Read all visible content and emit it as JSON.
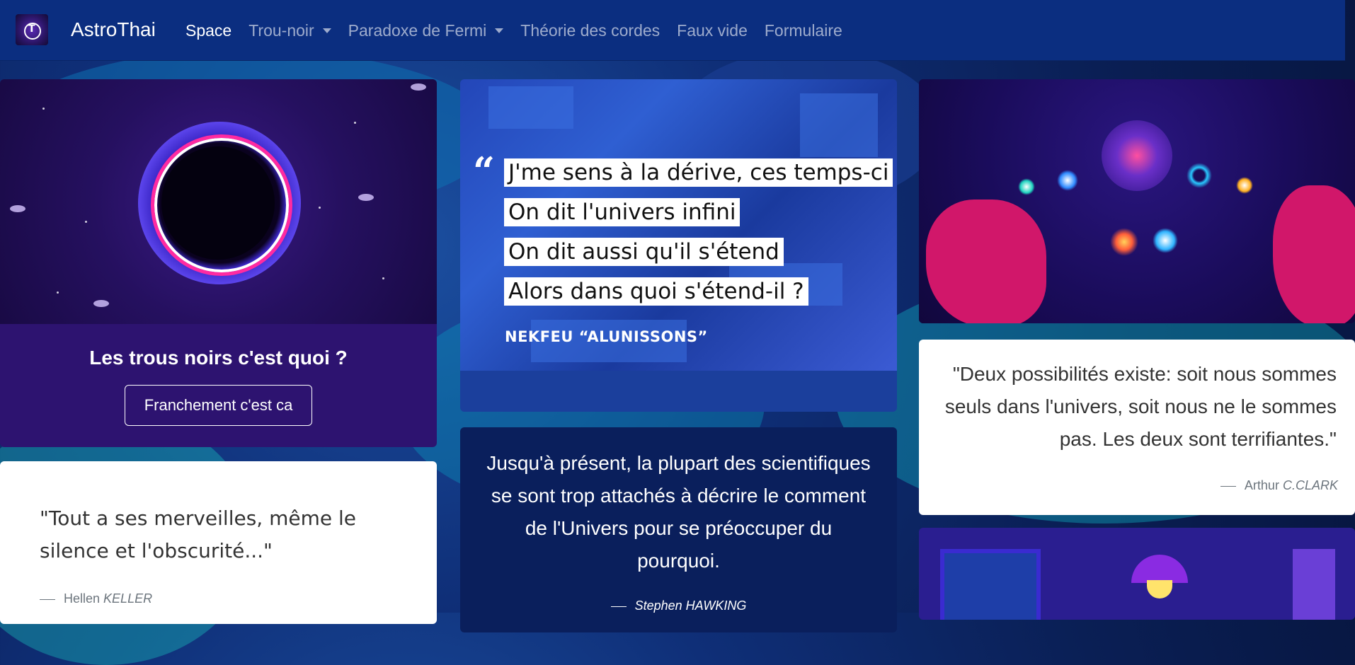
{
  "navbar": {
    "brand": "AstroThai",
    "links": [
      {
        "label": "Space",
        "active": true,
        "dropdown": false
      },
      {
        "label": "Trou-noir",
        "active": false,
        "dropdown": true
      },
      {
        "label": "Paradoxe de Fermi",
        "active": false,
        "dropdown": true
      },
      {
        "label": "Théorie des cordes",
        "active": false,
        "dropdown": false
      },
      {
        "label": "Faux vide",
        "active": false,
        "dropdown": false
      },
      {
        "label": "Formulaire",
        "active": false,
        "dropdown": false
      }
    ]
  },
  "blackhole_card": {
    "title": "Les trous noirs c'est quoi ?",
    "button_label": "Franchement c'est ca"
  },
  "keller_quote": {
    "text": "\"Tout a ses merveilles, même le silence et l'obscurité...\"",
    "author_first": "Hellen",
    "author_last": "KELLER"
  },
  "nekfeu_image": {
    "lines": [
      "J'me sens à la dérive, ces temps-ci",
      "On dit l'univers infini",
      "On dit aussi qu'il s'étend",
      "Alors dans quoi s'étend-il ?"
    ],
    "author": "NEKFEU “ALUNISSONS”"
  },
  "hawking_quote": {
    "text": "Jusqu'à présent, la plupart des scientifiques se sont trop attachés à décrire le comment de l'Univers pour se préoccuper du pourquoi.",
    "author": "Stephen HAWKING"
  },
  "clark_quote": {
    "text": "\"Deux possibilités existe: soit nous sommes seuls dans l'univers, soit nous ne le sommes pas. Les deux sont terrifiantes.\"",
    "author_first": "Arthur",
    "author_last": "C.CLARK"
  },
  "colors": {
    "navbar": "#0b2e80",
    "blackhole_card": "#2d1370",
    "hawking_card": "#0a1f5c",
    "accent_pink": "#ff2aa1"
  }
}
